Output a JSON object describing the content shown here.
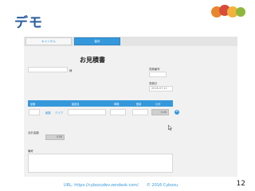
{
  "slide": {
    "title": "デモ",
    "footer": "URL: https://cybozudev.zendesk.com/　　© 2016 Cybozu",
    "page_number": "12"
  },
  "form": {
    "buttons": {
      "cancel": "キャンセル",
      "save": "保存"
    },
    "title": "お見積書",
    "customer_suffix": "様",
    "estimate_no_label": "見積番号",
    "date_label": "見積日",
    "date_value": "2016-07-12",
    "table": {
      "headers": [
        "品番",
        "製品名",
        "単価",
        "数量",
        "小計"
      ],
      "row": {
        "subtotal": "0.00",
        "edit_label": "編集",
        "clear_label": "クリア"
      }
    },
    "total_label": "合計金額",
    "total_value": "0.00",
    "remarks_label": "備考"
  }
}
